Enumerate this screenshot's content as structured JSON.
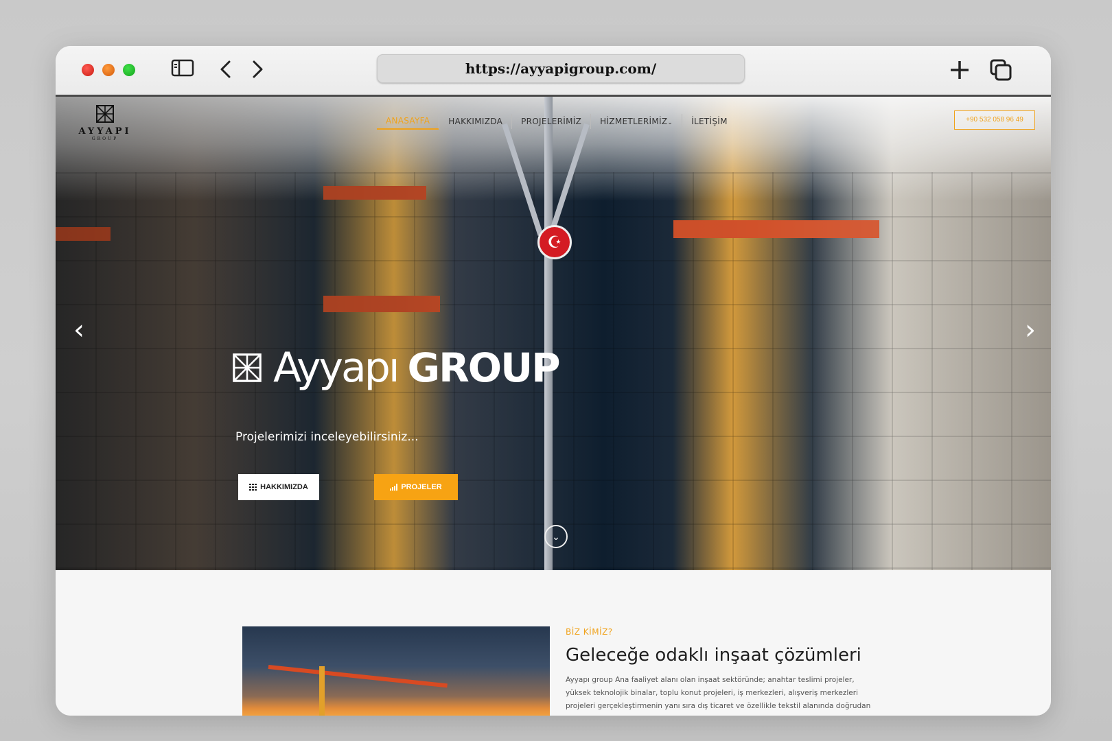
{
  "browser": {
    "url": "https://ayyapigroup.com/",
    "icons": [
      "sidebar-toggle-icon",
      "back-arrow-icon",
      "forward-arrow-icon",
      "plus-icon",
      "tabs-overview-icon"
    ]
  },
  "site": {
    "logo": {
      "word": "AYYAPI",
      "sub": "GROUP"
    },
    "nav": [
      {
        "label": "ANASAYFA",
        "active": true
      },
      {
        "label": "HAKKIMIZDA",
        "active": false
      },
      {
        "label": "PROJELERİMİZ",
        "active": false
      },
      {
        "label": "HİZMETLERİMİZ",
        "active": false,
        "has_dropdown": true
      },
      {
        "label": "İLETİŞİM",
        "active": false
      }
    ],
    "phone": "+90 532 058 96 49",
    "accent_color": "#f0a21a"
  },
  "hero": {
    "title_light": "Ayyapı",
    "title_bold": "GROUP",
    "subtitle": "Projelerimizi inceleyebilirsiniz...",
    "button_about": "HAKKIMIZDA",
    "button_projects": "PROJELER",
    "prev_icon": "‹",
    "next_icon": "›",
    "scroll_icon": "⌄"
  },
  "about": {
    "kicker": "BİZ KİMİZ?",
    "heading": "Geleceğe odaklı inşaat çözümleri",
    "paragraph": "Ayyapı group Ana faaliyet alanı olan inşaat sektöründe; anahtar teslimi projeler, yüksek teknolojik binalar, toplu konut projeleri, iş merkezleri, alışveriş merkezleri projeleri gerçekleştirmenin yanı sıra dış ticaret ve özellikle tekstil alanında doğrudan üretim ve"
  }
}
